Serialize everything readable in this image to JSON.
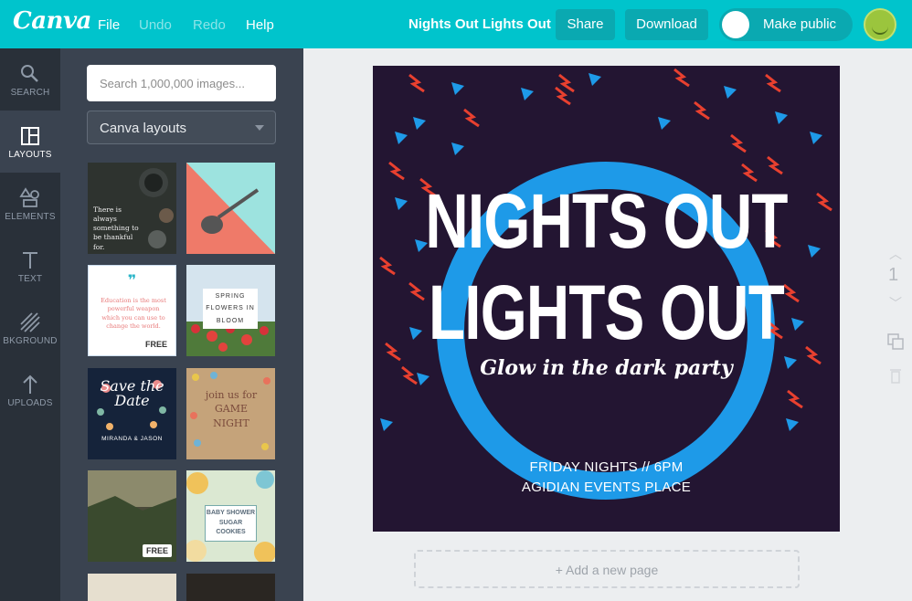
{
  "app": {
    "logo": "Canva",
    "menu": [
      "File",
      "Undo",
      "Redo",
      "Help"
    ],
    "doc_title": "Nights Out Lights Out",
    "share_label": "Share",
    "download_label": "Download",
    "make_public_label": "Make public",
    "brand_color": "#00c4cc"
  },
  "nav": {
    "items": [
      {
        "label": "SEARCH",
        "icon": "magnifier-icon"
      },
      {
        "label": "LAYOUTS",
        "icon": "layouts-icon"
      },
      {
        "label": "ELEMENTS",
        "icon": "shapes-icon"
      },
      {
        "label": "TEXT",
        "icon": "text-icon"
      },
      {
        "label": "BKGROUND",
        "icon": "stripes-icon"
      },
      {
        "label": "UPLOADS",
        "icon": "upload-arrow-icon"
      }
    ],
    "active": "LAYOUTS"
  },
  "panel": {
    "search_placeholder": "Search 1,000,000 images...",
    "dropdown_value": "Canva layouts",
    "thumbs": [
      {
        "text": "There is always something to be thankful for."
      },
      {
        "text": ""
      },
      {
        "text": "Education is the most powerful weapon which you can use to change the world.",
        "badge": "FREE"
      },
      {
        "text": "SPRING FLOWERS IN BLOOM"
      },
      {
        "text": "Save the Date",
        "sub": "MIRANDA & JASON"
      },
      {
        "text": "join us for GAME NIGHT"
      },
      {
        "text": "",
        "badge": "FREE"
      },
      {
        "text": "BABY SHOWER SUGAR COOKIES"
      }
    ]
  },
  "design": {
    "headline_1": "NIGHTS OUT",
    "headline_2": "LIGHTS OUT",
    "tagline": "Glow in the dark party",
    "info_1": "FRIDAY NIGHTS // 6PM",
    "info_2": "AGIDIAN EVENTS PLACE",
    "bg_color": "#231532",
    "ring_color": "#1e9ae8",
    "accent_red": "#e8402f"
  },
  "workspace": {
    "page_number": "1",
    "add_page_label": "+ Add a new page"
  }
}
